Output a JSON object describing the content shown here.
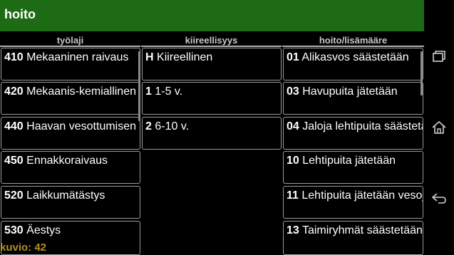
{
  "header": {
    "title": "hoito"
  },
  "columns": {
    "worktype": "työlaji",
    "urgency": "kiireellisyys",
    "care": "hoito/lisämääre"
  },
  "worktype_items": [
    {
      "code": "410",
      "label": "Mekaaninen raivaus"
    },
    {
      "code": "420",
      "label": "Mekaanis-kemiallinen"
    },
    {
      "code": "440",
      "label": "Haavan vesottumisen"
    },
    {
      "code": "450",
      "label": "Ennakkoraivaus"
    },
    {
      "code": "520",
      "label": "Laikkumätästys"
    },
    {
      "code": "530",
      "label": "Äestys"
    }
  ],
  "urgency_items": [
    {
      "code": "H",
      "label": "Kiireellinen"
    },
    {
      "code": "1",
      "label": "1-5 v."
    },
    {
      "code": "2",
      "label": "6-10 v."
    }
  ],
  "care_items": [
    {
      "code": "01",
      "label": "Alikasvos säästetään"
    },
    {
      "code": "03",
      "label": "Havupuita jätetään"
    },
    {
      "code": "04",
      "label": "Jaloja lehtipuita säästetään"
    },
    {
      "code": "10",
      "label": "Lehtipuita jätetään"
    },
    {
      "code": "11",
      "label": "Lehtipuita jätetään vesoja"
    },
    {
      "code": "13",
      "label": "Taimiryhmät säästetään"
    }
  ],
  "status": {
    "text": "kuvio: 42"
  },
  "nav": {
    "recents_icon": "recents-icon",
    "home_icon": "home-icon",
    "back_icon": "back-icon"
  }
}
